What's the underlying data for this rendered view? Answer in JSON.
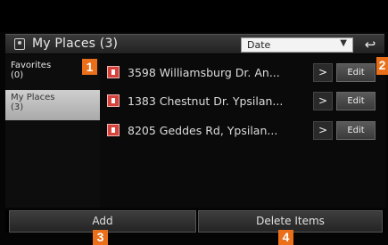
{
  "header": {
    "title": "My Places (3)",
    "sort_value": "Date",
    "sort_arrow": "▼",
    "back_glyph": "↩"
  },
  "sidebar": {
    "items": [
      {
        "label": "Favorites\n(0)",
        "active": false
      },
      {
        "label": "My Places\n(3)",
        "active": true
      }
    ]
  },
  "places": [
    {
      "address": "3598 Williamsburg Dr. An...",
      "chevron": ">",
      "edit_label": "Edit"
    },
    {
      "address": "1383 Chestnut Dr. Ypsilan...",
      "chevron": ">",
      "edit_label": "Edit"
    },
    {
      "address": "8205 Geddes Rd, Ypsilan...",
      "chevron": ">",
      "edit_label": "Edit"
    }
  ],
  "footer": {
    "add_label": "Add",
    "delete_label": "Delete Items"
  },
  "callouts": [
    "1",
    "2",
    "3",
    "4"
  ],
  "colors": {
    "accent": "#ea6f1a",
    "place_icon": "#d6433c"
  },
  "icons": {
    "header": "map-pin-icon",
    "place": "place-pin-icon",
    "back": "back-arrow-icon"
  }
}
